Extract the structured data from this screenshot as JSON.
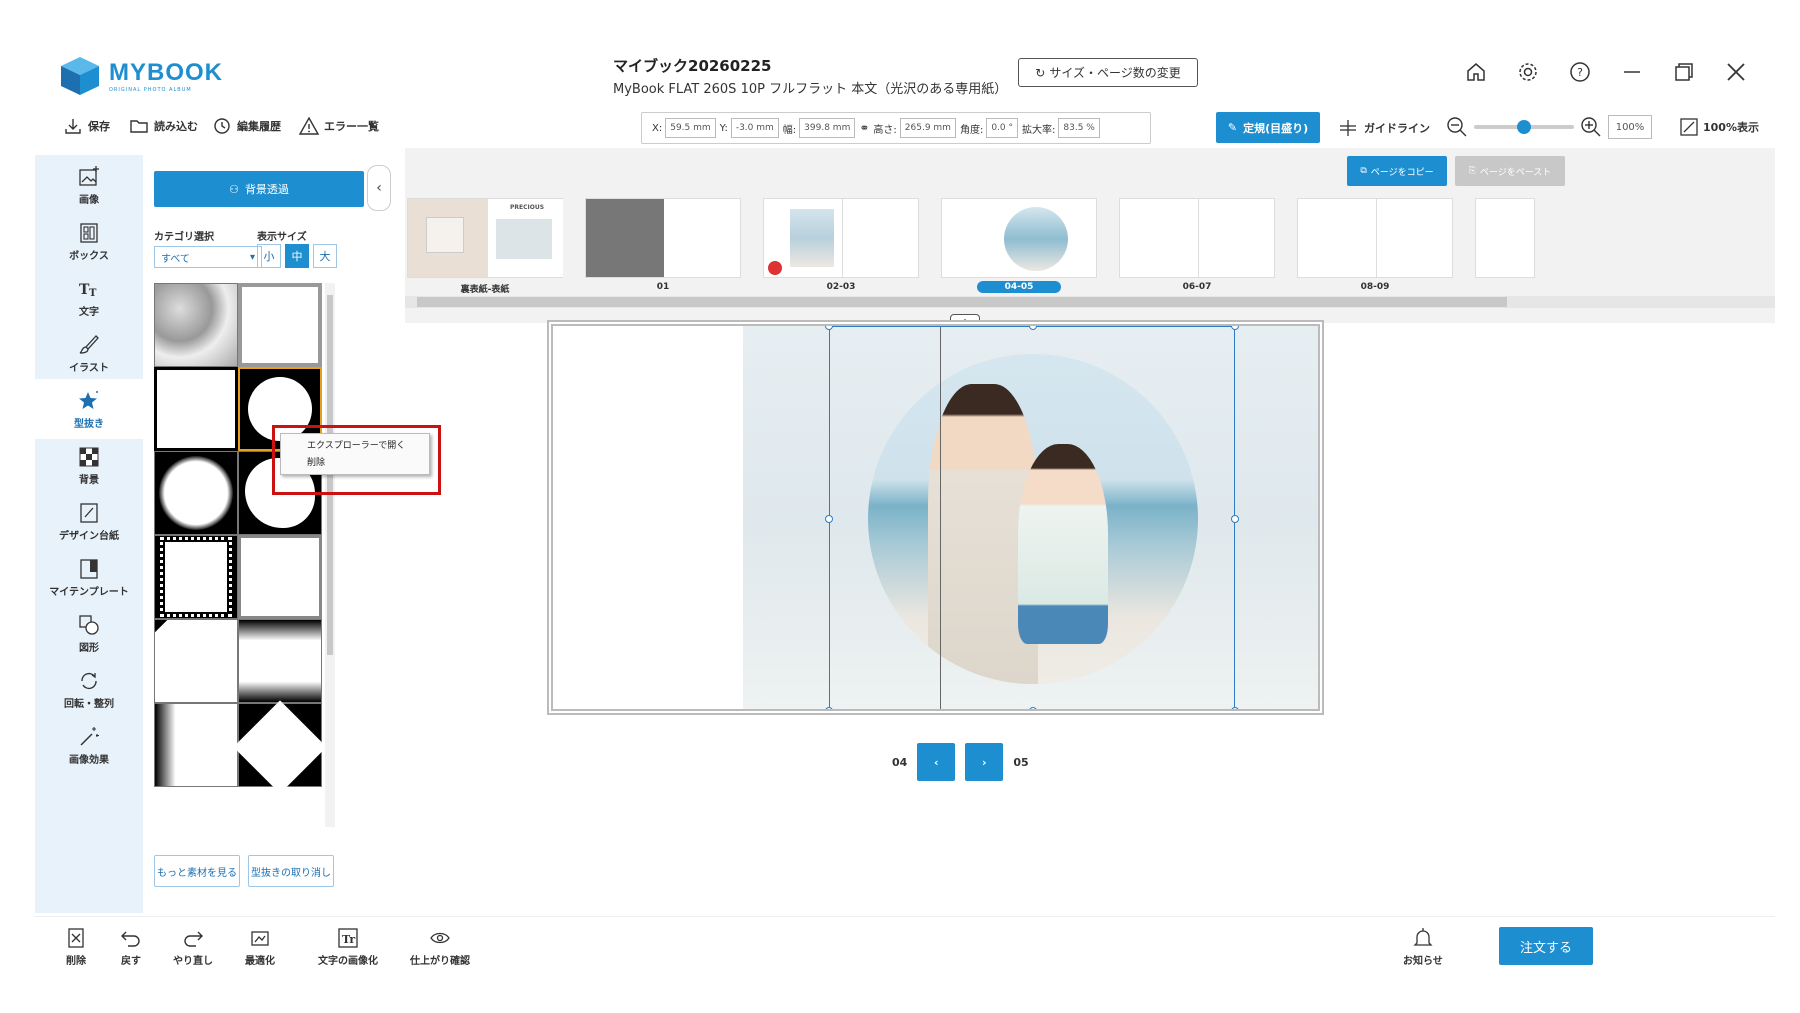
{
  "app": {
    "logo_text": "MYBOOK",
    "logo_sub": "ORIGINAL PHOTO ALBUM",
    "title": "マイブック20260225",
    "subtitle": "MyBook FLAT 260S 10P フルフラット 本文（光沢のある専用紙）",
    "size_button": "サイズ・ページ数の変更"
  },
  "toolbar": {
    "save": "保存",
    "load": "読み込む",
    "history": "編集履歴",
    "errors": "エラー一覧",
    "fields": [
      {
        "label": "X:",
        "value": "59.5 mm"
      },
      {
        "label": "Y:",
        "value": "-3.0 mm"
      },
      {
        "label": "幅:",
        "value": "399.8 mm"
      },
      {
        "label": "高さ:",
        "value": "265.9 mm"
      },
      {
        "label": "角度:",
        "value": "0.0 °"
      },
      {
        "label": "拡大率:",
        "value": "83.5 %"
      }
    ],
    "ruler": "定規(目盛り)",
    "guide": "ガイドライン",
    "zoom_value": "100%",
    "full_view": "100%表示"
  },
  "leftnav": [
    {
      "label": "画像",
      "icon": "image-add-icon"
    },
    {
      "label": "ボックス",
      "icon": "box-icon"
    },
    {
      "label": "文字",
      "icon": "text-icon"
    },
    {
      "label": "イラスト",
      "icon": "brush-icon"
    },
    {
      "label": "型抜き",
      "icon": "star-stamp-icon"
    },
    {
      "label": "背景",
      "icon": "checker-icon"
    },
    {
      "label": "デザイン台紙",
      "icon": "design-icon"
    },
    {
      "label": "マイテンプレート",
      "icon": "template-icon"
    },
    {
      "label": "図形",
      "icon": "shape-icon"
    },
    {
      "label": "回転・整列",
      "icon": "rotate-icon"
    },
    {
      "label": "画像効果",
      "icon": "magic-wand-icon"
    }
  ],
  "panel": {
    "bg_button": "背景透過",
    "category_label": "カテゴリ選択",
    "category_value": "すべて",
    "size_label": "表示サイズ",
    "sizes": [
      "小",
      "中",
      "大"
    ],
    "more_button": "もっと素材を見る",
    "cancel_button": "型抜きの取り消し"
  },
  "context_menu": {
    "items": [
      "エクスプローラーで開く",
      "削除"
    ]
  },
  "pages": {
    "copy": "ページをコピー",
    "paste": "ページをペースト",
    "labels": [
      "裏表紙-表紙",
      "01",
      "02-03",
      "04-05",
      "06-07",
      "08-09"
    ],
    "active": "04-05",
    "cover_word": "PRECIOUS"
  },
  "canvas": {
    "left_page": "04",
    "right_page": "05"
  },
  "bottombar": {
    "delete": "削除",
    "undo": "戻す",
    "redo": "やり直し",
    "optimize": "最適化",
    "text_to_image": "文字の画像化",
    "preview": "仕上がり確認",
    "notice": "お知らせ",
    "order": "注文する"
  },
  "colors": {
    "accent": "#1d8fd0",
    "highlight": "#cc1111"
  }
}
